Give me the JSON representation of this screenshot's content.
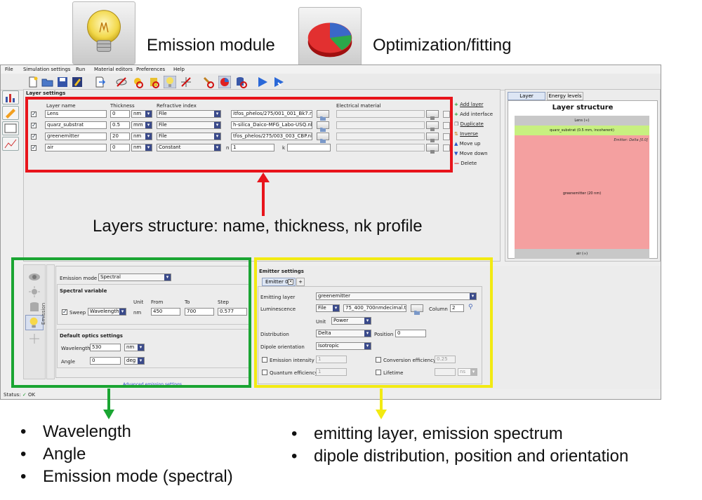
{
  "banner": {
    "emission_caption": "Emission module",
    "optimization_caption": "Optimization/fitting",
    "emission_icon": "lightbulb-icon",
    "optimization_icon": "pie-chart-icon"
  },
  "menu": [
    "File",
    "Simulation settings",
    "Run",
    "Material editors",
    "Preferences",
    "Help"
  ],
  "layer_settings": {
    "title": "Layer settings",
    "headers": {
      "name": "Layer name",
      "thickness": "Thickness",
      "refractive": "Refractive index",
      "electrical": "Electrical material"
    },
    "rows": [
      {
        "name": "Lens",
        "thickness": "0",
        "unit": "nm",
        "type": "File",
        "path": "itfos_phelos/275/001_001_Bk7.nk"
      },
      {
        "name": "quarz_substrat",
        "thickness": "0.5",
        "unit": "mm",
        "type": "File",
        "path": "h-silica_Daico-MFG_Labo-USQ.nk"
      },
      {
        "name": "greenemitter",
        "thickness": "20",
        "unit": "nm",
        "type": "File",
        "path": "tfos_phelos/275/003_003_CBP.nk"
      },
      {
        "name": "air",
        "thickness": "0",
        "unit": "nm",
        "type": "Constant",
        "n_label": "n",
        "n_value": "1",
        "k_label": "k"
      }
    ],
    "actions": [
      "Add layer",
      "Add interface",
      "Duplicate",
      "Inverse",
      "Move up",
      "Move down",
      "Delete"
    ]
  },
  "structure_panel": {
    "tabs": [
      "Layer structure",
      "Energy levels"
    ],
    "title": "Layer structure",
    "lens_label": "Lens (∞)",
    "quarz_label": "quarz_substrat (0.5 mm, incoherent)",
    "emitter_note": "Emitter: Delta [0.0]",
    "green_label": "greenemitter (20 nm)",
    "air_label": "air (∞)"
  },
  "emission": {
    "mode_label": "Emission mode",
    "mode_value": "Spectral",
    "spectral_title": "Spectral variable",
    "unit_header": "Unit",
    "from_header": "From",
    "to_header": "To",
    "step_header": "Step",
    "sweep_label": "Sweep",
    "sweep_value": "Wavelength",
    "sweep_unit": "nm",
    "from_value": "450",
    "to_value": "700",
    "step_value": "0.577",
    "optics_title": "Default optics settings",
    "wavelength_label": "Wavelength",
    "wavelength_value": "530",
    "wavelength_unit": "nm",
    "angle_label": "Angle",
    "angle_value": "0",
    "angle_unit": "deg",
    "vertical_tab": "Emission",
    "advanced_link": "Advanced emission settings"
  },
  "emitter": {
    "title": "Emitter settings",
    "tab_label": "Emitter 0",
    "emitting_layer_label": "Emitting layer",
    "emitting_layer_value": "greenemitter",
    "luminescence_label": "Luminescence",
    "luminescence_type": "File",
    "luminescence_path": "75_400_700nmdecimal.txt",
    "column_label": "Column",
    "column_value": "2",
    "unit_label": "Unit",
    "unit_value": "Power",
    "distribution_label": "Distribution",
    "distribution_value": "Delta",
    "position_label": "Position",
    "position_value": "0",
    "dipole_label": "Dipole orientation",
    "dipole_value": "Isotropic",
    "emission_intensity_label": "Emission intensity",
    "emission_intensity_value": "1",
    "conversion_label": "Conversion efficiency",
    "conversion_value": "0.25",
    "quantum_label": "Quantum efficiency",
    "quantum_value": "1",
    "lifetime_label": "Lifetime",
    "lifetime_unit": "ns"
  },
  "status": {
    "label": "Status:",
    "value": "OK"
  },
  "annotations": {
    "layers_text": "Layers structure: name, thickness, nk profile",
    "left_bullets": [
      "Wavelength",
      "Angle",
      "Emission mode (spectral)"
    ],
    "right_bullets": [
      "emitting layer, emission spectrum",
      "dipole distribution, position and orientation"
    ],
    "colors": {
      "red": "#e8141b",
      "green": "#1aa532",
      "yellow": "#f2ea12"
    }
  }
}
